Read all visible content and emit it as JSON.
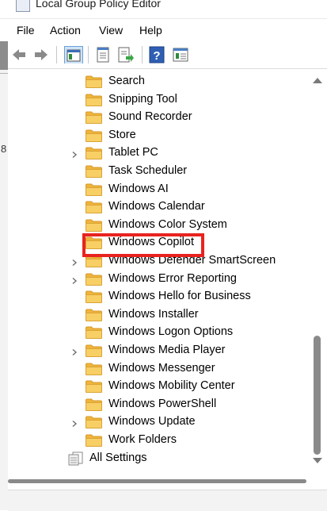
{
  "window": {
    "title": "Local Group Policy Editor"
  },
  "menu": [
    "File",
    "Action",
    "View",
    "Help"
  ],
  "toolbar": {
    "buttons": [
      "back-arrow-icon",
      "forward-arrow-icon",
      "show-hide-console-tree-icon",
      "properties-icon",
      "export-list-icon",
      "help-icon",
      "view-options-icon"
    ]
  },
  "background_window": {
    "edge_char": "8"
  },
  "tree": {
    "items": [
      {
        "label": "Search",
        "expandable": false
      },
      {
        "label": "Snipping Tool",
        "expandable": false
      },
      {
        "label": "Sound Recorder",
        "expandable": false
      },
      {
        "label": "Store",
        "expandable": false
      },
      {
        "label": "Tablet PC",
        "expandable": true
      },
      {
        "label": "Task Scheduler",
        "expandable": false
      },
      {
        "label": "Windows AI",
        "expandable": false
      },
      {
        "label": "Windows Calendar",
        "expandable": false
      },
      {
        "label": "Windows Color System",
        "expandable": false
      },
      {
        "label": "Windows Copilot",
        "expandable": false,
        "highlighted": true
      },
      {
        "label": "Windows Defender SmartScreen",
        "expandable": true
      },
      {
        "label": "Windows Error Reporting",
        "expandable": true
      },
      {
        "label": "Windows Hello for Business",
        "expandable": false
      },
      {
        "label": "Windows Installer",
        "expandable": false
      },
      {
        "label": "Windows Logon Options",
        "expandable": false
      },
      {
        "label": "Windows Media Player",
        "expandable": true
      },
      {
        "label": "Windows Messenger",
        "expandable": false
      },
      {
        "label": "Windows Mobility Center",
        "expandable": false
      },
      {
        "label": "Windows PowerShell",
        "expandable": false
      },
      {
        "label": "Windows Update",
        "expandable": true
      },
      {
        "label": "Work Folders",
        "expandable": false
      }
    ],
    "all_settings": "All Settings"
  },
  "colors": {
    "highlight_box": "#e8231f",
    "folder": "#f5c451"
  }
}
